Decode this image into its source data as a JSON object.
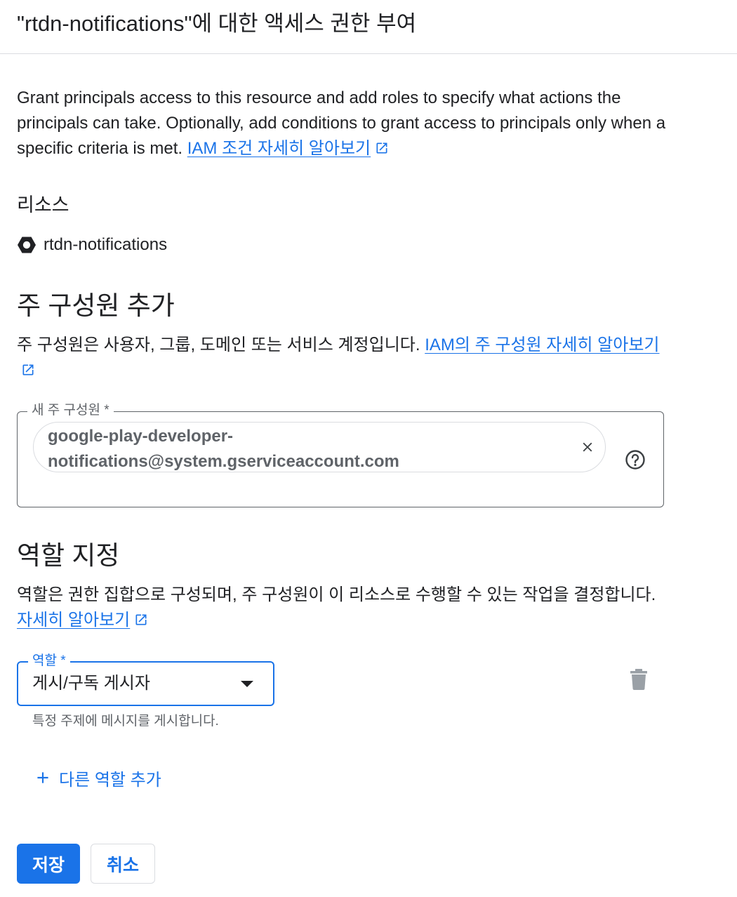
{
  "header": {
    "title": "\"rtdn-notifications\"에 대한 액세스 권한 부여"
  },
  "intro": {
    "text": "Grant principals access to this resource and add roles to specify what actions the principals can take. Optionally, add conditions to grant access to principals only when a specific criteria is met.",
    "link_label": "IAM 조건 자세히 알아보기"
  },
  "resource": {
    "heading": "리소스",
    "name": "rtdn-notifications",
    "icon": "pubsub-hexagon-icon"
  },
  "add_principals": {
    "title": "주 구성원 추가",
    "description": "주 구성원은 사용자, 그룹, 도메인 또는 서비스 계정입니다.",
    "link_label": "IAM의 주 구성원 자세히 알아보기",
    "field_label": "새 주 구성원 *",
    "chip_value": "google-play-developer-notifications@system.gserviceaccount.com"
  },
  "assign_roles": {
    "title": "역할 지정",
    "description": "역할은 권한 집합으로 구성되며, 주 구성원이 이 리소스로 수행할 수 있는 작업을 결정합니다.",
    "link_label": "자세히 알아보기",
    "role_label": "역할 *",
    "role_value": "게시/구독 게시자",
    "role_hint": "특정 주제에 메시지를 게시합니다.",
    "add_role_label": "다른 역할 추가"
  },
  "actions": {
    "save_label": "저장",
    "cancel_label": "취소"
  },
  "colors": {
    "accent": "#1a73e8",
    "text": "#202124",
    "muted": "#5f6368",
    "border": "#dadce0"
  }
}
